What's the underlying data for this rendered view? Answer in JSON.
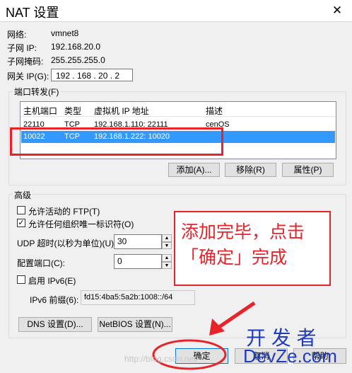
{
  "window": {
    "title": "NAT 设置",
    "close_glyph": "✕"
  },
  "info": {
    "network_label": "网络:",
    "network_value": "vmnet8",
    "subnet_ip_label": "子网 IP:",
    "subnet_ip_value": "192.168.20.0",
    "subnet_mask_label": "子网掩码:",
    "subnet_mask_value": "255.255.255.0",
    "gateway_label": "网关 IP(G):",
    "gateway_value": "192 . 168 . 20  .  2"
  },
  "port_forwarding": {
    "legend": "端口转发(F)",
    "columns": [
      "主机端口",
      "类型",
      "虚拟机 IP 地址",
      "描述"
    ],
    "rows": [
      {
        "host_port": "22110",
        "type": "TCP",
        "vm_address": "192.168.1.110: 22111",
        "description": "cenOS"
      },
      {
        "host_port": "10022",
        "type": "TCP",
        "vm_address": "192.168.1.222: 10020",
        "description": ""
      }
    ],
    "add_label": "添加(A)...",
    "remove_label": "移除(R)",
    "properties_label": "属性(P)"
  },
  "advanced": {
    "legend": "高级",
    "allow_ftp_label": "允许活动的 FTP(T)",
    "allow_ftp_checked": false,
    "allow_oui_label": "允许任何组织唯一标识符(O)",
    "allow_oui_checked": true,
    "udp_timeout_label": "UDP 超时(以秒为单位)(U):",
    "udp_timeout_value": "30",
    "config_port_label": "配置端口(C):",
    "config_port_value": "0",
    "enable_ipv6_label": "启用 IPv6(E)",
    "enable_ipv6_checked": false,
    "ipv6_prefix_label": "IPv6 前缀(6):",
    "ipv6_prefix_value": "fd15:4ba5:5a2b:1008::/64",
    "dns_label": "DNS 设置(D)...",
    "netbios_label": "NetBIOS 设置(N)..."
  },
  "footer": {
    "ok_label": "确定",
    "cancel_label": "取消",
    "help_label": "帮助"
  },
  "annotation": {
    "line1": "添加完毕，点击",
    "line2": "「确定」完成",
    "color": "#e8232a"
  },
  "watermarks": {
    "top": "开 发 者",
    "bottom": "DevZe.com",
    "blog": "http://blog.csdn.net/"
  }
}
